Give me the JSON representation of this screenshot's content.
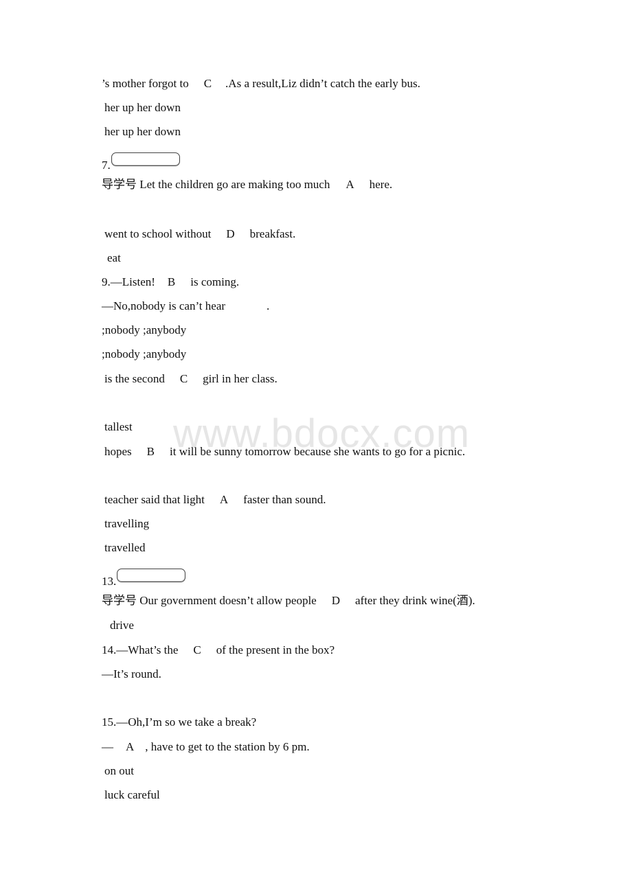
{
  "watermark": "www.bdocx.com",
  "lines": [
    {
      "pre": "’s mother forgot to",
      "ans": "C",
      "post": ".As a result,Liz didn’t catch the early bus."
    },
    {
      "text": "her up her down"
    },
    {
      "text": "her up her down"
    },
    {
      "num": "7."
    },
    {
      "pre": "导学号 Let the children go are making too much",
      "ans": "A",
      "post": "here."
    },
    {
      "pre": "went to school without",
      "ans": "D",
      "post": "breakfast."
    },
    {
      "text": "eat"
    },
    {
      "pre": "9.—Listen!",
      "ans": "B",
      "post": "is coming."
    },
    {
      "pre": "—No,nobody is can’t hear",
      "post": "."
    },
    {
      "text": ";nobody ;anybody"
    },
    {
      "text": ";nobody ;anybody"
    },
    {
      "pre": "is the second",
      "ans": "C",
      "post": "girl in her class."
    },
    {
      "text": "tallest"
    },
    {
      "pre": "hopes",
      "ans": "B",
      "post": "it will be sunny tomorrow because she wants to go for a picnic."
    },
    {
      "pre": "teacher said that light",
      "ans": "A",
      "post": "faster than sound."
    },
    {
      "text": "travelling"
    },
    {
      "text": "travelled"
    },
    {
      "num": "13."
    },
    {
      "pre": "导学号 Our government doesn’t allow people",
      "ans": "D",
      "post": "after they drink wine(酒)."
    },
    {
      "text": "drive"
    },
    {
      "pre": "14.—What’s the",
      "ans": "C",
      "post": "of the present in the box?"
    },
    {
      "text": "—It’s round."
    },
    {
      "text": "15.—Oh,I’m so we take a break?"
    },
    {
      "pre": "—",
      "ans": "A",
      "post": ", have to get to the station by 6 pm."
    },
    {
      "text": "on out"
    },
    {
      "text": "luck careful"
    }
  ]
}
